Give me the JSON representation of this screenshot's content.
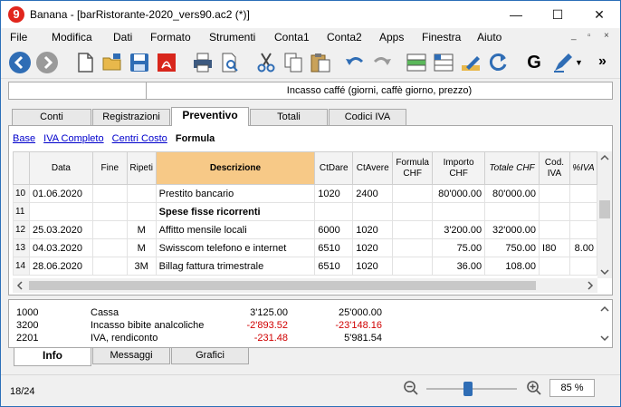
{
  "window": {
    "title": "Banana - [barRistorante-2020_vers90.ac2 (*)]",
    "logo_glyph": "9",
    "controls": [
      "—",
      "☐",
      "✕"
    ]
  },
  "menu": [
    "File",
    "Modifica",
    "Dati",
    "Formato",
    "Strumenti",
    "Conta1",
    "Conta2",
    "Apps",
    "Finestra",
    "Aiuto"
  ],
  "mdi_controls": [
    "_",
    "▫",
    "×"
  ],
  "toolbar": {
    "icons": [
      "back-icon",
      "forward-icon",
      "new-file-icon",
      "open-folder-icon",
      "save-icon",
      "pdf-icon",
      "print-icon",
      "print-preview-icon",
      "cut-icon",
      "copy-icon",
      "paste-icon",
      "undo-icon",
      "redo-icon",
      "add-row-icon",
      "insert-rows-icon",
      "edit-pencil-icon",
      "recheck-icon",
      "g-icon",
      "pen-icon"
    ],
    "g_label": "G",
    "more": "»",
    "accent_blue": "#2f6db5"
  },
  "formula_bar": {
    "cell_ref": "",
    "content": "Incasso caffé (giorni, caffè giorno, prezzo)"
  },
  "tabs": [
    "Conti",
    "Registrazioni",
    "Preventivo",
    "Totali",
    "Codici IVA"
  ],
  "active_tab": "Preventivo",
  "views": {
    "links": [
      "Base",
      "IVA Completo",
      "Centri Costo"
    ],
    "active": "Formula"
  },
  "table": {
    "headers": [
      "Data",
      "Fine",
      "Ripeti",
      "Descrizione",
      "CtDare",
      "CtAvere",
      "Formula CHF",
      "Importo CHF",
      "Totale CHF",
      "Cod. IVA",
      "%IVA"
    ],
    "rows": [
      {
        "n": "10",
        "data": "01.06.2020",
        "fine": "",
        "ripeti": "",
        "desc": "Prestito bancario",
        "ctdare": "1020",
        "ctavere": "2400",
        "formula": "",
        "importo": "80'000.00",
        "totale": "80'000.00",
        "codiva": "",
        "piva": "",
        "bold": false
      },
      {
        "n": "11",
        "data": "",
        "fine": "",
        "ripeti": "",
        "desc": "Spese fisse ricorrenti",
        "ctdare": "",
        "ctavere": "",
        "formula": "",
        "importo": "",
        "totale": "",
        "codiva": "",
        "piva": "",
        "bold": true
      },
      {
        "n": "12",
        "data": "25.03.2020",
        "fine": "",
        "ripeti": "M",
        "desc": "Affitto mensile locali",
        "ctdare": "6000",
        "ctavere": "1020",
        "formula": "",
        "importo": "3'200.00",
        "totale": "32'000.00",
        "codiva": "",
        "piva": "",
        "bold": false
      },
      {
        "n": "13",
        "data": "04.03.2020",
        "fine": "",
        "ripeti": "M",
        "desc": "Swisscom telefono e internet",
        "ctdare": "6510",
        "ctavere": "1020",
        "formula": "",
        "importo": "75.00",
        "totale": "750.00",
        "codiva": "I80",
        "piva": "8.00",
        "bold": false
      },
      {
        "n": "14",
        "data": "28.06.2020",
        "fine": "",
        "ripeti": "3M",
        "desc": "Billag fattura trimestrale",
        "ctdare": "6510",
        "ctavere": "1020",
        "formula": "",
        "importo": "36.00",
        "totale": "108.00",
        "codiva": "",
        "piva": "",
        "bold": false
      }
    ]
  },
  "info": {
    "rows": [
      {
        "account": "1000",
        "label": "Cassa",
        "v1": "3'125.00",
        "v2": "25'000.00",
        "v1_neg": false,
        "v2_neg": false
      },
      {
        "account": "3200",
        "label": "Incasso bibite analcoliche",
        "v1": "-2'893.52",
        "v2": "-23'148.16",
        "v1_neg": true,
        "v2_neg": true
      },
      {
        "account": "2201",
        "label": "IVA, rendiconto",
        "v1": "-231.48",
        "v2": "5'981.54",
        "v1_neg": true,
        "v2_neg": false
      }
    ]
  },
  "bottom_tabs": [
    "Info",
    "Messaggi",
    "Grafici"
  ],
  "active_bottom_tab": "Info",
  "status": {
    "position": "18/24",
    "zoom_level": 0.46,
    "zoom": "85 %"
  },
  "colors": {
    "header_highlight": "#f7c987",
    "negative": "#d00000",
    "link": "#0000cc"
  }
}
